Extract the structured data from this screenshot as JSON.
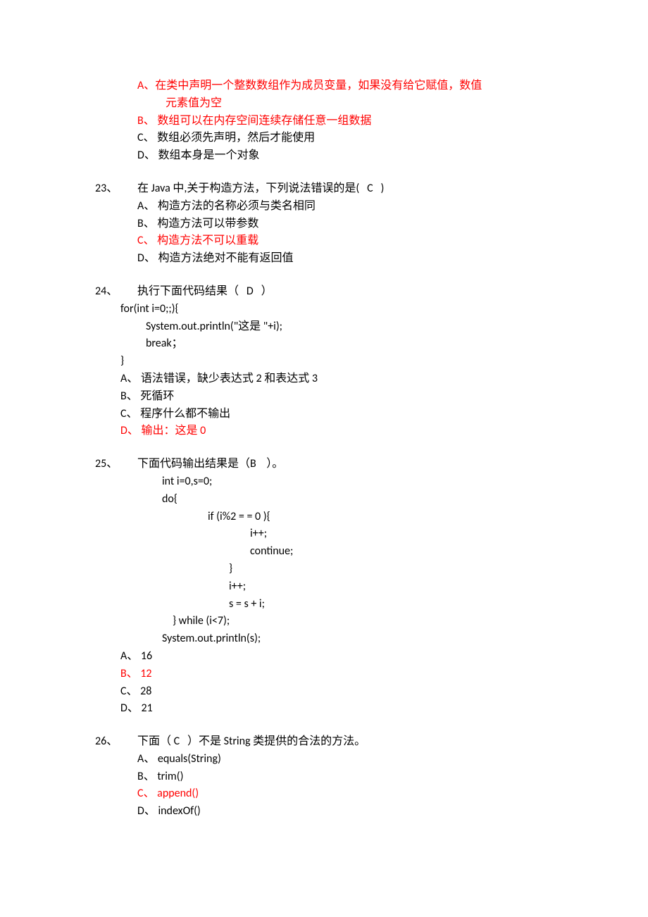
{
  "q22_options": {
    "a_prefix": "A、",
    "a_line1": "在类中声明一个整数数组作为成员变量，如果没有给它赋值，数值",
    "a_line2": "元素值为空",
    "b": "B、 数组可以在内存空间连续存储任意一组数据",
    "c": "C、 数组必须先声明，然后才能使用",
    "d": "D、 数组本身是一个对象"
  },
  "q23": {
    "num": "23、",
    "stem_pre": "在 Java 中,关于构造方法，下列说法错误的是(",
    "answer": "C",
    "stem_post": ")",
    "a": "A、 构造方法的名称必须与类名相同",
    "b": "B、 构造方法可以带参数",
    "c": "C、 构造方法不可以重载",
    "d": "D、 构造方法绝对不能有返回值"
  },
  "q24": {
    "num": "24、",
    "stem_pre": "执行下面代码结果（",
    "answer": "D",
    "stem_post": "）",
    "code1": "for(int i=0;;){",
    "code2": "System.out.println(\"这是  \"+i);",
    "code3": "break；",
    "code4": "}",
    "a": "A、 语法错误，缺少表达式 2 和表达式 3",
    "b": "B、 死循环",
    "c": "C、 程序什么都不输出",
    "d": "D、 输出：这是 0"
  },
  "q25": {
    "num": "25、",
    "stem_pre": "下面代码输出结果是（B",
    "stem_post": "）。",
    "code1": "int i=0,s=0;",
    "code2": "do{",
    "code3": "if (i%2 = = 0 ){",
    "code4": "i++;",
    "code5": "continue;",
    "code6": "}",
    "code7": "i++;",
    "code8": "s = s + i;",
    "code9": "} while (i<7);",
    "code10": "System.out.println(s);",
    "a": "A、 16",
    "b": "B、 12",
    "c": "C、 28",
    "d": "D、 21"
  },
  "q26": {
    "num": "26、",
    "stem_pre": "下面（ C",
    "stem_post": "）不是 String 类提供的合法的方法。",
    "a": "A、 equals(String)",
    "b": "B、 trim()",
    "c": "C、 append()",
    "d": "D、 indexOf()"
  }
}
